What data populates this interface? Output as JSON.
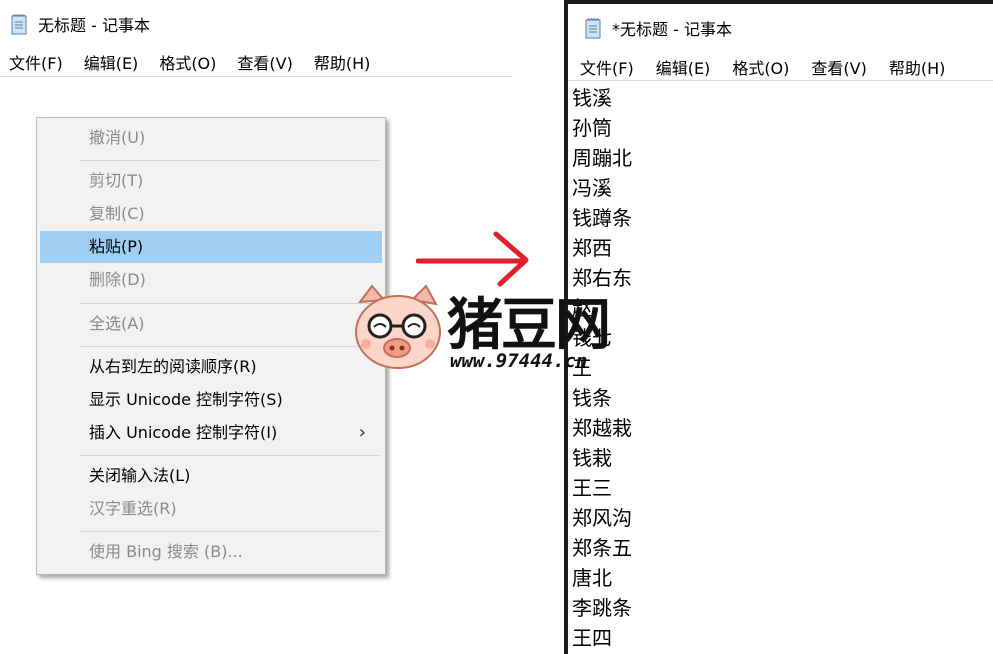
{
  "left_window": {
    "title": "无标题 - 记事本",
    "menu": [
      "文件(F)",
      "编辑(E)",
      "格式(O)",
      "查看(V)",
      "帮助(H)"
    ]
  },
  "context_menu": {
    "items": [
      {
        "label": "撤消(U)",
        "enabled": false
      },
      {
        "label": "剪切(T)",
        "enabled": false
      },
      {
        "label": "复制(C)",
        "enabled": false
      },
      {
        "label": "粘贴(P)",
        "enabled": true,
        "highlighted": true
      },
      {
        "label": "删除(D)",
        "enabled": false
      },
      {
        "label": "全选(A)",
        "enabled": false
      },
      {
        "label": "从右到左的阅读顺序(R)",
        "enabled": true
      },
      {
        "label": "显示 Unicode 控制字符(S)",
        "enabled": true
      },
      {
        "label": "插入 Unicode 控制字符(I)",
        "enabled": true,
        "submenu": true
      },
      {
        "label": "关闭输入法(L)",
        "enabled": true
      },
      {
        "label": "汉字重选(R)",
        "enabled": false
      },
      {
        "label": "使用 Bing 搜索 (B)...",
        "enabled": false
      }
    ],
    "submenu_glyph": "›"
  },
  "right_window": {
    "title": "*无标题 - 记事本",
    "menu": [
      "文件(F)",
      "编辑(E)",
      "格式(O)",
      "查看(V)",
      "帮助(H)"
    ],
    "lines": [
      "钱溪",
      "孙筒",
      "周蹦北",
      "冯溪",
      "钱蹲条",
      "郑西",
      "郑右东",
      "赵",
      "钱七",
      "王",
      "钱条",
      "郑越栽",
      "钱栽",
      "王三",
      "郑风沟",
      "郑条五",
      "唐北",
      "李跳条",
      "王四"
    ]
  },
  "watermark": {
    "brand": "猪豆网",
    "url": "www.97444.cn"
  },
  "colors": {
    "highlight": "#9ecff2",
    "arrow": "#e0202a",
    "disabled_text": "#8a8a8a"
  },
  "icons": [
    "notepad-icon",
    "red-arrow-icon",
    "pig-mascot-icon",
    "chevron-right-icon"
  ]
}
